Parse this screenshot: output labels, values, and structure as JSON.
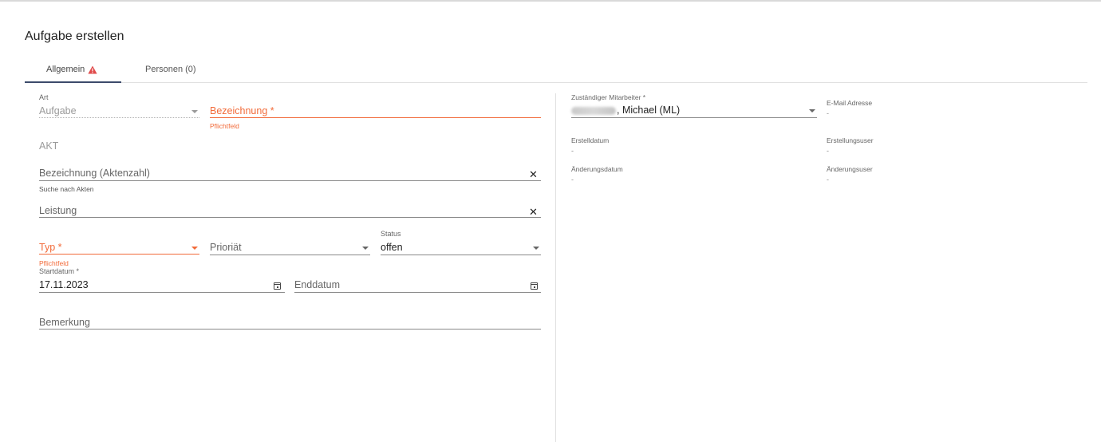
{
  "dialog": {
    "title": "Aufgabe erstellen"
  },
  "tabs": [
    {
      "label": "Allgemein",
      "active": true,
      "warning_icon": "warning-triangle-icon"
    },
    {
      "label": "Personen (0)",
      "active": false
    }
  ],
  "colors": {
    "error": "#f26b3a",
    "tab_indicator": "#3c4b6b",
    "warning": "#e04a4a"
  },
  "form": {
    "art": {
      "label": "Art",
      "value": "Aufgabe"
    },
    "bezeichnung": {
      "placeholder": "Bezeichnung *",
      "error": "Pflichtfeld"
    },
    "akt_section": "AKT",
    "aktenzahl": {
      "placeholder": "Bezeichnung (Aktenzahl)",
      "hint": "Suche nach Akten"
    },
    "leistung": {
      "placeholder": "Leistung"
    },
    "typ": {
      "placeholder": "Typ *",
      "error": "Pflichtfeld"
    },
    "prioritaet": {
      "placeholder": "Prioriät"
    },
    "status": {
      "label": "Status",
      "value": "offen"
    },
    "startdatum": {
      "label": "Startdatum *",
      "value": "17.11.2023"
    },
    "enddatum": {
      "placeholder": "Enddatum"
    },
    "bemerkung": {
      "placeholder": "Bemerkung"
    }
  },
  "right": {
    "mitarbeiter": {
      "label": "Zuständiger Mitarbeiter *",
      "value": ", Michael (ML)"
    },
    "email": {
      "label": "E-Mail Adresse",
      "value": "-"
    },
    "erstelldatum": {
      "label": "Erstelldatum",
      "value": "-"
    },
    "erstellungsuser": {
      "label": "Erstellungsuser",
      "value": "-"
    },
    "aenderungsdatum": {
      "label": "Änderungsdatum",
      "value": "-"
    },
    "aenderungsuser": {
      "label": "Änderungsuser",
      "value": "-"
    }
  }
}
